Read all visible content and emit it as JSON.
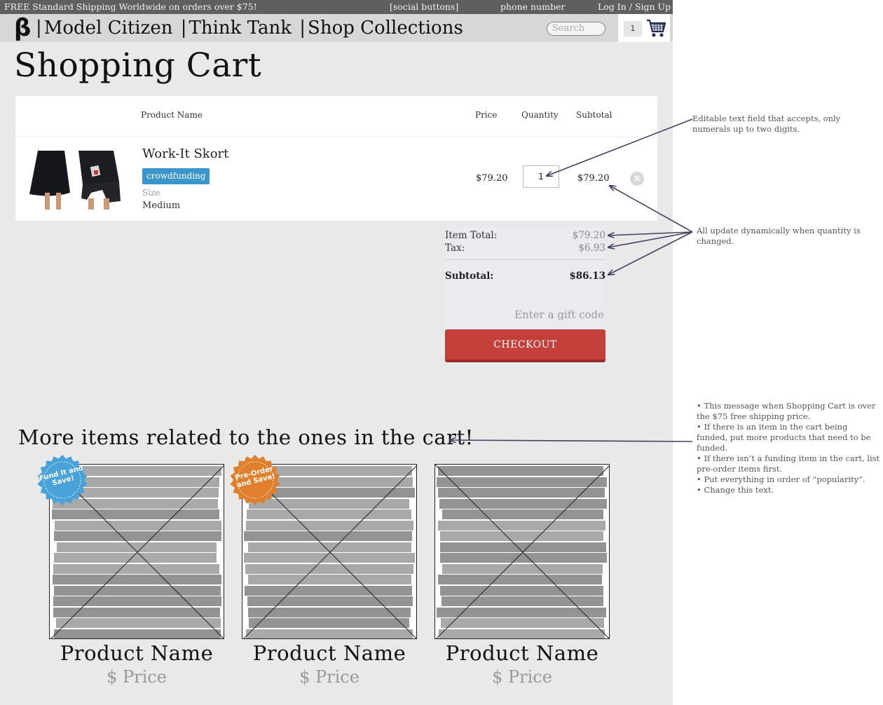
{
  "topbar": {
    "shipping_msg": "FREE Standard Shipping Worldwide on orders over $75!",
    "social": "[social buttons]",
    "phone": "phone number",
    "login": "Log In / Sign Up"
  },
  "nav": {
    "logo": "β",
    "links": [
      "Model Citizen",
      "Think Tank",
      "Shop Collections"
    ],
    "search_placeholder": "Search",
    "cart_count": "1"
  },
  "page_title": "Shopping Cart",
  "cart": {
    "headers": {
      "product": "Product Name",
      "price": "Price",
      "quantity": "Quantity",
      "subtotal": "Subtotal"
    },
    "item": {
      "name": "Work-It Skort",
      "tag": "crowdfunding",
      "size_label": "Size",
      "size_value": "Medium",
      "price": "$79.20",
      "quantity": "1",
      "subtotal": "$79.20"
    }
  },
  "totals": {
    "item_total_label": "Item Total:",
    "item_total": "$79.20",
    "tax_label": "Tax:",
    "tax": "$6.93",
    "subtotal_label": "Subtotal:",
    "subtotal": "$86.13",
    "gift_placeholder": "Enter a gift code",
    "checkout_label": "CHECKOUT"
  },
  "related": {
    "heading": "More items related to the ones in the cart!",
    "products": [
      {
        "name": "Product Name",
        "price": "$ Price",
        "badge": "Fund It and Save!",
        "badge_color": "#4aa3d8"
      },
      {
        "name": "Product Name",
        "price": "$ Price",
        "badge": "Pre-Order and Save!",
        "badge_color": "#e07f2c"
      },
      {
        "name": "Product Name",
        "price": "$ Price",
        "badge": "",
        "badge_color": ""
      }
    ]
  },
  "annotations": {
    "quantity_note": "Editable text field that accepts, only numerals up to two digits.",
    "totals_note": "All update dynamically when quantity is changed.",
    "related_notes": [
      "• This message when Shopping Cart is over the $75 free shipping price.",
      "• If there is an item in the cart being funded, put more products that need to be funded.",
      "• If there isn’t a funding item in the cart, list pre-order items first.",
      "• Put everything in order of “popularity”.",
      "• Change this text."
    ]
  },
  "colors": {
    "checkout": "#c3403a",
    "tag": "#3a95c9",
    "topbar": "#5f5f5f",
    "annotation_arrow": "#4a3f5e"
  }
}
